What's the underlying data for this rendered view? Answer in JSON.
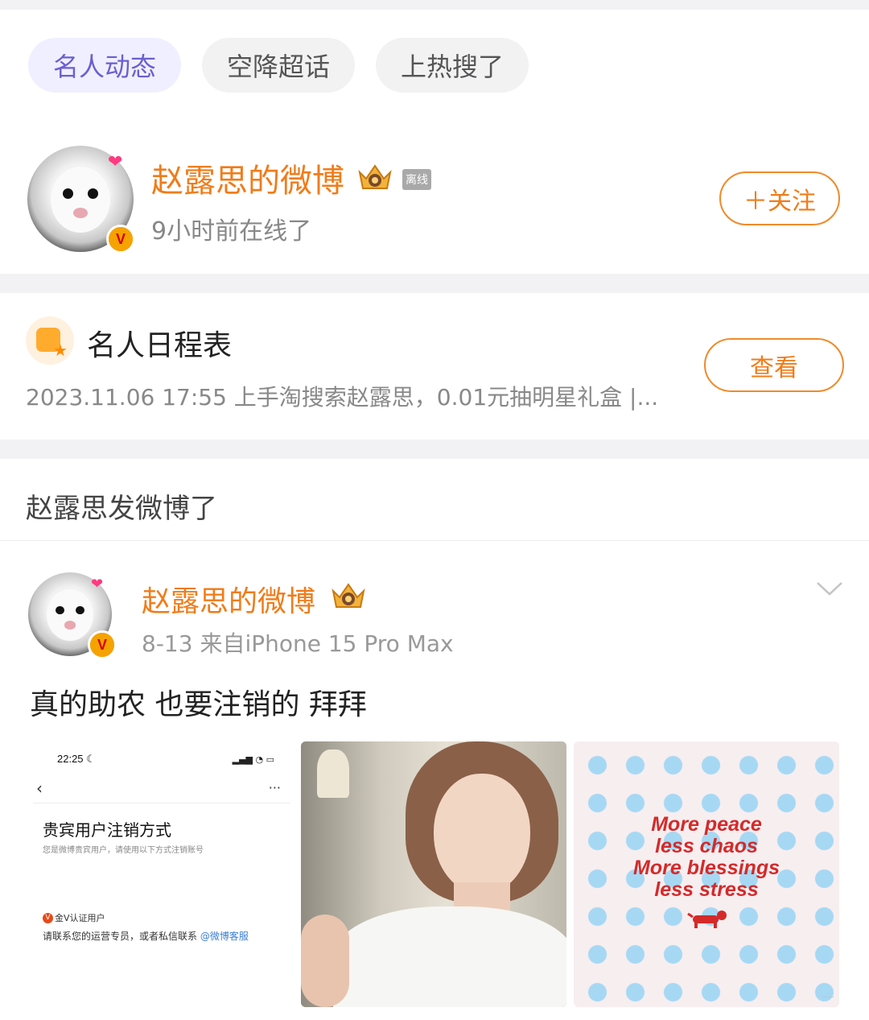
{
  "tabs": [
    {
      "label": "名人动态",
      "active": true
    },
    {
      "label": "空降超话",
      "active": false
    },
    {
      "label": "上热搜了",
      "active": false
    }
  ],
  "user": {
    "name": "赵露思的微博",
    "status_badge": "离线",
    "online_text": "9小时前在线了",
    "follow_label": "＋关注"
  },
  "schedule": {
    "title": "名人日程表",
    "desc": "2023.11.06 17:55 上手淘搜索赵露思，0.01元抽明星礼盒 |...",
    "view_label": "查看"
  },
  "section": {
    "title": "赵露思发微博了"
  },
  "post": {
    "author": "赵露思的微博",
    "meta": "8-13  来自iPhone 15 Pro Max",
    "text": "真的助农 也要注销的 拜拜",
    "images": [
      {
        "kind": "screenshot",
        "status_time": "22:25",
        "title": "贵宾用户注销方式",
        "subtitle": "您是微博贵宾用户，请使用以下方式注销账号",
        "v_label": "金V认证用户",
        "contact_text": "请联系您的运营专员，或者私信联系",
        "contact_link": "@微博客服"
      },
      {
        "kind": "photo"
      },
      {
        "kind": "quote",
        "lines": [
          "More peace",
          "less chaos",
          "More blessings",
          "less stress"
        ]
      }
    ]
  },
  "colors": {
    "accent_orange": "#f07c1a",
    "active_tab": "#6a5fd0",
    "quote_red": "#d42a2a",
    "dot_blue": "#a6d8f4"
  }
}
